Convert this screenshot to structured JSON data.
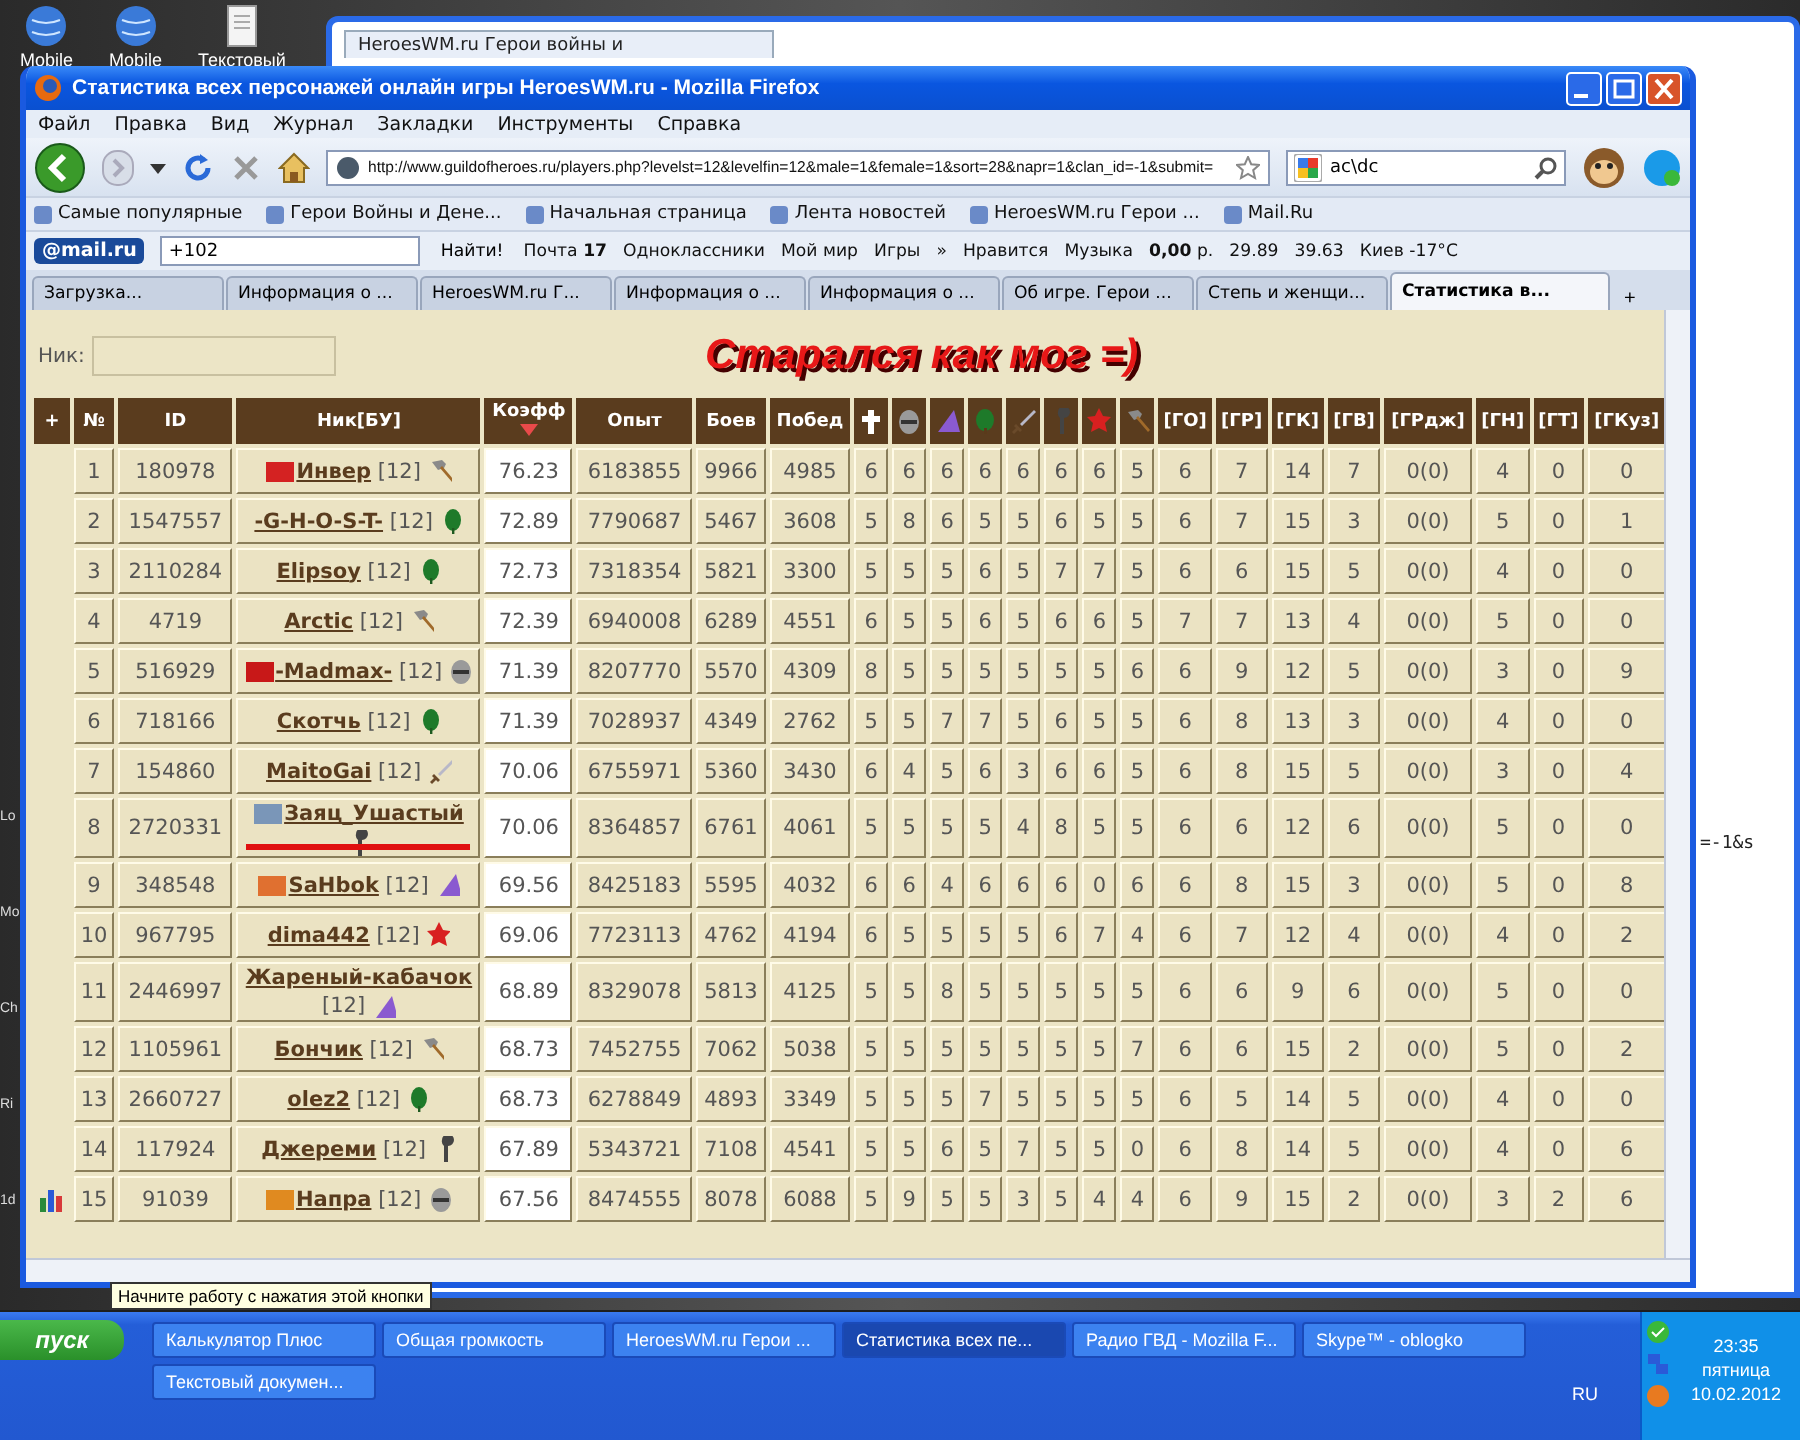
{
  "desktop": {
    "icons": [
      {
        "label": "Mobile"
      },
      {
        "label": "Mobile"
      },
      {
        "label": "Текстовый"
      }
    ],
    "edge_labels": [
      "Lo",
      "Mo",
      "Ch",
      "Ri",
      "1d"
    ]
  },
  "background_window": {
    "tab": "HeroesWM.ru Герои войны и",
    "url_fragment": "=-1&s"
  },
  "window": {
    "title": "Статистика всех персонажей онлайн игры HeroesWM.ru - Mozilla Firefox",
    "menu": [
      "Файл",
      "Правка",
      "Вид",
      "Журнал",
      "Закладки",
      "Инструменты",
      "Справка"
    ],
    "url": "http://www.guildofheroes.ru/players.php?levelst=12&levelfin=12&male=1&female=1&sort=28&napr=1&clan_id=-1&submit=",
    "search": "ac\\dc",
    "bookmarks": [
      "Самые популярные",
      "Герои Войны и Дене...",
      "Начальная страница",
      "Лента новостей",
      "HeroesWM.ru Герои ...",
      "Mail.Ru"
    ],
    "mail_toolbar": {
      "logo": "@mail.ru",
      "search_value": "+102",
      "find_button": "Найти!",
      "items": [
        "Почта **17**",
        "Одноклассники",
        "Мой мир",
        "Игры",
        "»",
        "Нравится",
        "Музыка",
        "**0,00** р.",
        "29.89",
        "39.63",
        "Киев -17°C"
      ]
    },
    "tabs": [
      {
        "label": "Загрузка...",
        "selected": false
      },
      {
        "label": "Информация о ...",
        "selected": false
      },
      {
        "label": "HeroesWM.ru Г...",
        "selected": false
      },
      {
        "label": "Информация о ...",
        "selected": false
      },
      {
        "label": "Информация о ...",
        "selected": false
      },
      {
        "label": "Об игре. Герои ...",
        "selected": false
      },
      {
        "label": "Степь и женщи...",
        "selected": false
      },
      {
        "label": "Статистика в...",
        "selected": true
      }
    ],
    "new_tab": "+"
  },
  "page": {
    "nick_label": "Ник:",
    "banner": "Старался как мог =)",
    "table": {
      "columns": [
        {
          "kind": "text",
          "label": "+",
          "sorted": false
        },
        {
          "kind": "text",
          "label": "№",
          "sorted": false
        },
        {
          "kind": "text",
          "label": "ID",
          "sorted": false
        },
        {
          "kind": "text",
          "label": "Ник[БУ]",
          "sorted": false
        },
        {
          "kind": "text",
          "label": "Коэфф",
          "sorted": true
        },
        {
          "kind": "text",
          "label": "Опыт",
          "sorted": false
        },
        {
          "kind": "text",
          "label": "Боев",
          "sorted": false
        },
        {
          "kind": "text",
          "label": "Побед",
          "sorted": false
        },
        {
          "kind": "cross",
          "sorted": false
        },
        {
          "kind": "helmet",
          "sorted": false
        },
        {
          "kind": "hat",
          "sorted": false
        },
        {
          "kind": "tree",
          "sorted": false
        },
        {
          "kind": "sword",
          "sorted": false
        },
        {
          "kind": "staff",
          "sorted": false
        },
        {
          "kind": "star",
          "sorted": false
        },
        {
          "kind": "hammer",
          "sorted": false
        },
        {
          "kind": "text",
          "label": "[ГО]",
          "sorted": false
        },
        {
          "kind": "text",
          "label": "[ГР]",
          "sorted": false
        },
        {
          "kind": "text",
          "label": "[ГК]",
          "sorted": false
        },
        {
          "kind": "text",
          "label": "[ГВ]",
          "sorted": false
        },
        {
          "kind": "text",
          "label": "[ГРдж]",
          "sorted": false
        },
        {
          "kind": "text",
          "label": "[ГН]",
          "sorted": false
        },
        {
          "kind": "text",
          "label": "[ГТ]",
          "sorted": false
        },
        {
          "kind": "text",
          "label": "[ГКуз]",
          "sorted": false
        }
      ],
      "rows": [
        {
          "stats_icon": false,
          "no": "1",
          "id": "180978",
          "color": "#d42222",
          "nick": "Инвер",
          "combat_level": "[12]",
          "kind": "hammer",
          "marked": false,
          "coef": "76.23",
          "exp": "6183855",
          "battles": "9966",
          "wins": "4985",
          "stats": [
            "6",
            "6",
            "6",
            "6",
            "6",
            "6",
            "6",
            "5",
            "6",
            "7",
            "14",
            "7",
            "0(0)",
            "4",
            "0",
            "0"
          ]
        },
        {
          "stats_icon": false,
          "no": "2",
          "id": "1547557",
          "nick": "-G-H-O-S-T-",
          "combat_level": "[12]",
          "kind": "leaf",
          "marked": false,
          "coef": "72.89",
          "exp": "7790687",
          "battles": "5467",
          "wins": "3608",
          "stats": [
            "5",
            "8",
            "6",
            "5",
            "5",
            "6",
            "5",
            "5",
            "6",
            "7",
            "15",
            "3",
            "0(0)",
            "5",
            "0",
            "1"
          ]
        },
        {
          "stats_icon": false,
          "no": "3",
          "id": "2110284",
          "nick": "Elipsoy",
          "combat_level": "[12]",
          "kind": "leaf",
          "marked": false,
          "coef": "72.73",
          "exp": "7318354",
          "battles": "5821",
          "wins": "3300",
          "stats": [
            "5",
            "5",
            "5",
            "6",
            "5",
            "7",
            "7",
            "5",
            "6",
            "6",
            "15",
            "5",
            "0(0)",
            "4",
            "0",
            "0"
          ]
        },
        {
          "stats_icon": false,
          "no": "4",
          "id": "4719",
          "nick": "Arctic",
          "combat_level": "[12]",
          "kind": "hammer",
          "marked": false,
          "coef": "72.39",
          "exp": "6940008",
          "battles": "6289",
          "wins": "4551",
          "stats": [
            "6",
            "5",
            "5",
            "6",
            "5",
            "6",
            "6",
            "5",
            "7",
            "7",
            "13",
            "4",
            "0(0)",
            "5",
            "0",
            "0"
          ]
        },
        {
          "stats_icon": false,
          "no": "5",
          "id": "516929",
          "color": "#c81818",
          "nick": "-Madmax-",
          "combat_level": "[12]",
          "kind": "helmet",
          "marked": false,
          "coef": "71.39",
          "exp": "8207770",
          "battles": "5570",
          "wins": "4309",
          "stats": [
            "8",
            "5",
            "5",
            "5",
            "5",
            "5",
            "5",
            "6",
            "6",
            "9",
            "12",
            "5",
            "0(0)",
            "3",
            "0",
            "9"
          ]
        },
        {
          "stats_icon": false,
          "no": "6",
          "id": "718166",
          "nick": "Скотчь",
          "combat_level": "[12]",
          "kind": "leaf",
          "marked": false,
          "coef": "71.39",
          "exp": "7028937",
          "battles": "4349",
          "wins": "2762",
          "stats": [
            "5",
            "5",
            "7",
            "7",
            "5",
            "6",
            "5",
            "5",
            "6",
            "8",
            "13",
            "3",
            "0(0)",
            "4",
            "0",
            "0"
          ]
        },
        {
          "stats_icon": false,
          "no": "7",
          "id": "154860",
          "nick": "MaitoGai",
          "combat_level": "[12]",
          "kind": "sword",
          "marked": false,
          "coef": "70.06",
          "exp": "6755971",
          "battles": "5360",
          "wins": "3430",
          "stats": [
            "6",
            "4",
            "5",
            "6",
            "3",
            "6",
            "6",
            "5",
            "6",
            "8",
            "15",
            "5",
            "0(0)",
            "3",
            "0",
            "4"
          ]
        },
        {
          "stats_icon": false,
          "no": "8",
          "id": "2720331",
          "color": "#7a96b8",
          "nick": "Заяц_Ушастый",
          "kind": "staff",
          "marked": true,
          "coef": "70.06",
          "exp": "8364857",
          "battles": "6761",
          "wins": "4061",
          "stats": [
            "5",
            "5",
            "5",
            "5",
            "4",
            "8",
            "5",
            "5",
            "6",
            "6",
            "12",
            "6",
            "0(0)",
            "5",
            "0",
            "0"
          ]
        },
        {
          "stats_icon": false,
          "no": "9",
          "id": "348548",
          "color": "#e07030",
          "nick": "SaHbok",
          "combat_level": "[12]",
          "kind": "hat",
          "marked": false,
          "coef": "69.56",
          "exp": "8425183",
          "battles": "5595",
          "wins": "4032",
          "stats": [
            "6",
            "6",
            "4",
            "6",
            "6",
            "6",
            "0",
            "6",
            "6",
            "8",
            "15",
            "3",
            "0(0)",
            "5",
            "0",
            "8"
          ]
        },
        {
          "stats_icon": false,
          "no": "10",
          "id": "967795",
          "nick": "dima442",
          "combat_level": "[12]",
          "kind": "star",
          "marked": false,
          "coef": "69.06",
          "exp": "7723113",
          "battles": "4762",
          "wins": "4194",
          "stats": [
            "6",
            "5",
            "5",
            "5",
            "5",
            "6",
            "7",
            "4",
            "6",
            "7",
            "12",
            "4",
            "0(0)",
            "4",
            "0",
            "2"
          ]
        },
        {
          "stats_icon": false,
          "no": "11",
          "id": "2446997",
          "nick": "Жареный-кабачок",
          "combat_level": "[12]",
          "kind": "hat",
          "marked": false,
          "coef": "68.89",
          "exp": "8329078",
          "battles": "5813",
          "wins": "4125",
          "stats": [
            "5",
            "5",
            "8",
            "5",
            "5",
            "5",
            "5",
            "5",
            "6",
            "6",
            "9",
            "6",
            "0(0)",
            "5",
            "0",
            "0"
          ]
        },
        {
          "stats_icon": false,
          "no": "12",
          "id": "1105961",
          "nick": "Бончик",
          "combat_level": "[12]",
          "kind": "hammer",
          "marked": false,
          "coef": "68.73",
          "exp": "7452755",
          "battles": "7062",
          "wins": "5038",
          "stats": [
            "5",
            "5",
            "5",
            "5",
            "5",
            "5",
            "5",
            "7",
            "6",
            "6",
            "15",
            "2",
            "0(0)",
            "5",
            "0",
            "2"
          ]
        },
        {
          "stats_icon": false,
          "no": "13",
          "id": "2660727",
          "nick": "olez2",
          "combat_level": "[12]",
          "kind": "leaf",
          "marked": false,
          "coef": "68.73",
          "exp": "6278849",
          "battles": "4893",
          "wins": "3349",
          "stats": [
            "5",
            "5",
            "5",
            "7",
            "5",
            "5",
            "5",
            "5",
            "6",
            "5",
            "14",
            "5",
            "0(0)",
            "4",
            "0",
            "0"
          ]
        },
        {
          "stats_icon": false,
          "no": "14",
          "id": "117924",
          "nick": "Джереми",
          "combat_level": "[12]",
          "kind": "staff",
          "marked": false,
          "coef": "67.89",
          "exp": "5343721",
          "battles": "7108",
          "wins": "4541",
          "stats": [
            "5",
            "5",
            "6",
            "5",
            "7",
            "5",
            "5",
            "0",
            "6",
            "8",
            "14",
            "5",
            "0(0)",
            "4",
            "0",
            "6"
          ]
        },
        {
          "stats_icon": true,
          "no": "15",
          "id": "91039",
          "color": "#e08a20",
          "nick": "Напра",
          "combat_level": "[12]",
          "kind": "helmet",
          "marked": false,
          "coef": "67.56",
          "exp": "8474555",
          "battles": "8078",
          "wins": "6088",
          "stats": [
            "5",
            "9",
            "5",
            "5",
            "3",
            "5",
            "4",
            "4",
            "6",
            "9",
            "15",
            "2",
            "0(0)",
            "3",
            "2",
            "6"
          ]
        }
      ]
    }
  },
  "tooltip": "Начните работу с нажатия этой кнопки",
  "taskbar": {
    "start": "пуск",
    "buttons": [
      {
        "label": "Калькулятор Плюс",
        "selected": false
      },
      {
        "label": "Общая громкость",
        "selected": false
      },
      {
        "label": "HeroesWM.ru Герои ...",
        "selected": false
      },
      {
        "label": "Статистика всех пе...",
        "selected": true
      },
      {
        "label": "Радио ГВД - Mozilla F...",
        "selected": false
      },
      {
        "label": "Skype™ - oblogko",
        "selected": false
      },
      {
        "label": "Текстовый докумен...",
        "selected": false
      }
    ],
    "language": "RU",
    "time": "23:35",
    "weekday": "пятница",
    "date": "10.02.2012"
  }
}
